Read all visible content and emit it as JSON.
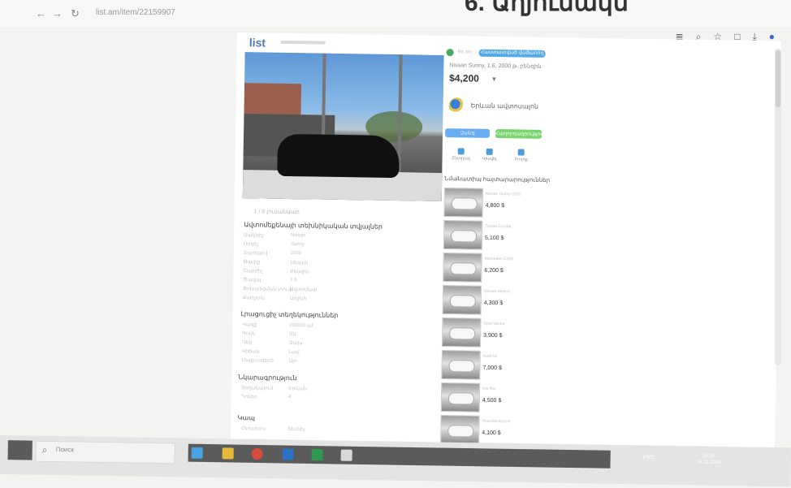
{
  "browser": {
    "url": "list.am/item/22159907",
    "overlay_title": "6. Աղյուսակն"
  },
  "site": {
    "logo": "list"
  },
  "listing": {
    "seller": "list.am",
    "badge": "Հաստատված վաճառող",
    "title": "Nissan Sunny, 1.6, 2000 թ. բենզին",
    "price": "$4,200",
    "dealer": "Երևան ավտոսալոն",
    "call_button": "Զանգ",
    "message_button": "Հաղորդագրություն",
    "actions": [
      {
        "icon": "favorite-icon",
        "label": "Ընտրյալ"
      },
      {
        "icon": "share-icon",
        "label": "Կիսվել"
      },
      {
        "icon": "report-icon",
        "label": "Բողոք"
      }
    ],
    "photo_caption": "1 / 8 լուսանկար"
  },
  "specs": {
    "title": "Ավտոմեքենայի տեխնիկական տվյալներ",
    "rows": [
      {
        "k": "Մակնիշ",
        "v": "Nissan"
      },
      {
        "k": "Մոդել",
        "v": "Sunny"
      },
      {
        "k": "Տարեթիվ",
        "v": "2000"
      },
      {
        "k": "Թափք",
        "v": "Սեդան"
      },
      {
        "k": "Շարժիչ",
        "v": "Բենզին"
      },
      {
        "k": "Ծավալ",
        "v": "1.6"
      },
      {
        "k": "Փոխանցման տուփ",
        "v": "Ավտոմատ"
      },
      {
        "k": "Քարշակ",
        "v": "Առջևի"
      }
    ],
    "section2": "Լրացուցիչ տեղեկություններ",
    "rows2": [
      {
        "k": "Վազք",
        "v": "230000 կմ"
      },
      {
        "k": "Գույն",
        "v": "Սև"
      },
      {
        "k": "Ղեկ",
        "v": "Ձախ"
      },
      {
        "k": "Վիճակ",
        "v": "Լավ"
      },
      {
        "k": "Մաքսազերծ",
        "v": "Այո"
      }
    ],
    "section3": "Նկարագրություն",
    "rows3": [
      {
        "k": "Տեղակայում",
        "v": "Երևան"
      },
      {
        "k": "Դռներ",
        "v": "4"
      }
    ],
    "section4": "Կապ",
    "rows4": [
      {
        "k": "Հեռախոս",
        "v": "Տեսնել"
      }
    ]
  },
  "similar": {
    "title": "Նմանատիպ հայտարարություններ",
    "items": [
      {
        "name": "Nissan Sunny 2001",
        "price": "4,800 $"
      },
      {
        "name": "Toyota Corolla",
        "price": "5,100 $"
      },
      {
        "name": "Mercedes C200",
        "price": "6,200 $"
      },
      {
        "name": "Nissan Almera",
        "price": "4,300 $"
      },
      {
        "name": "Opel Vectra",
        "price": "3,900 $"
      },
      {
        "name": "Audi A4",
        "price": "7,000 $"
      },
      {
        "name": "Kia Rio",
        "price": "4,500 $"
      },
      {
        "name": "Hyundai Accent",
        "price": "4,100 $"
      }
    ]
  },
  "taskbar": {
    "search": "Поиск",
    "lang": "РУС",
    "time": "16:22",
    "date": "26.11.2024"
  }
}
